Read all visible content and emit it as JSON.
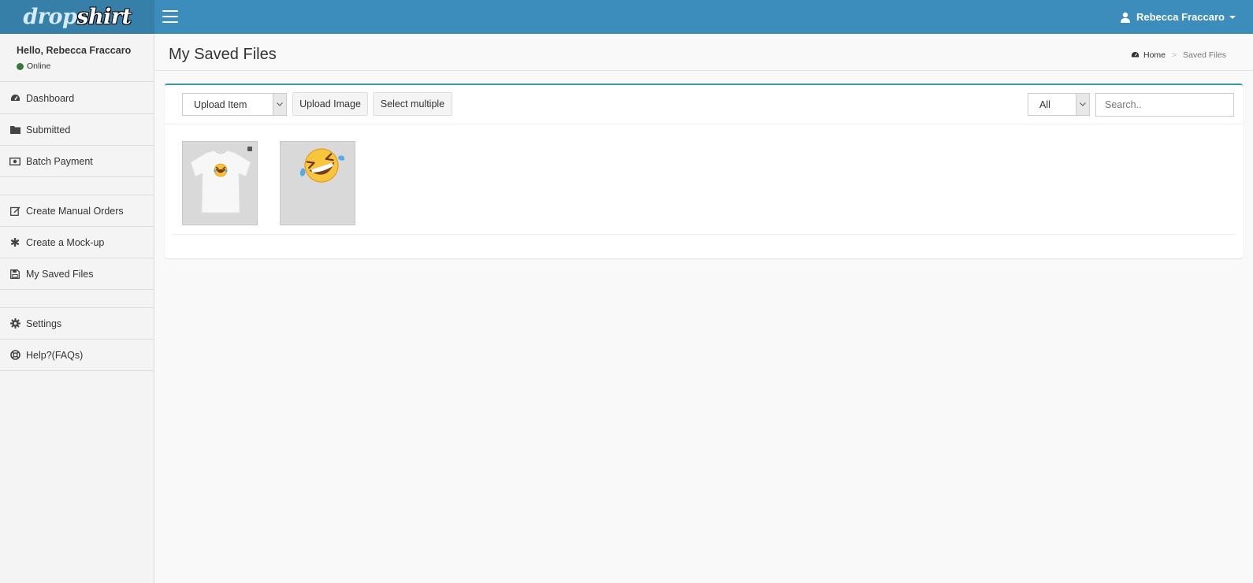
{
  "brand": {
    "logo_part1": "drop",
    "logo_part2": "shirt"
  },
  "header": {
    "user_name": "Rebecca Fraccaro"
  },
  "sidebar": {
    "greeting": "Hello, Rebecca Fraccaro",
    "status": "Online",
    "status_color": "#3c763d",
    "items": [
      {
        "label": "Dashboard",
        "icon": "dashboard-icon"
      },
      {
        "label": "Submitted",
        "icon": "folder-icon"
      },
      {
        "label": "Batch Payment",
        "icon": "money-icon"
      },
      {
        "label": "Create Manual Orders",
        "icon": "edit-icon"
      },
      {
        "label": "Create a Mock-up",
        "icon": "asterisk-icon"
      },
      {
        "label": "My Saved Files",
        "icon": "save-icon"
      },
      {
        "label": "Settings",
        "icon": "gear-icon"
      },
      {
        "label": "Help?(FAQs)",
        "icon": "lifebuoy-icon"
      }
    ]
  },
  "page": {
    "title": "My Saved Files",
    "breadcrumb": {
      "home": "Home",
      "current": "Saved Files"
    }
  },
  "toolbar": {
    "upload_item": "Upload Item",
    "upload_image": "Upload Image",
    "select_multiple": "Select multiple",
    "filter_value": "All",
    "search_placeholder": "Search.."
  },
  "files": [
    {
      "type": "tshirt-mockup",
      "icon": "tshirt-icon"
    },
    {
      "type": "emoji-image",
      "icon": "laughing-emoji-icon"
    }
  ],
  "colors": {
    "topbar": "#3c8dbc",
    "logo_bg": "#367fa9",
    "box_accent": "#3c9a9a"
  }
}
